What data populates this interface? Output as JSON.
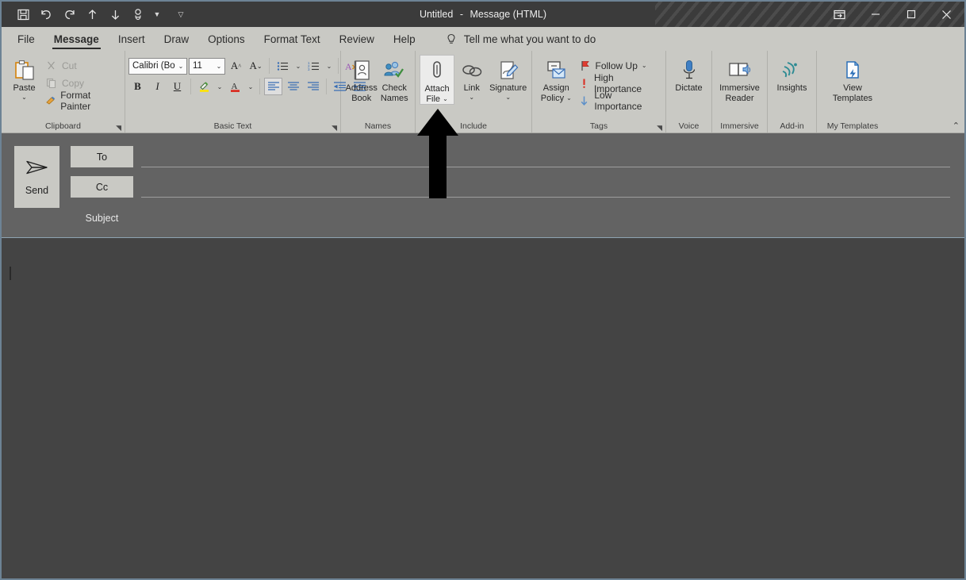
{
  "window": {
    "title_document": "Untitled",
    "title_separator": "-",
    "title_type": "Message (HTML)",
    "colors": {
      "titlebar": "#3b3b3b",
      "ribbon": "#c9c9c4",
      "compose_header": "#636363",
      "body": "#fdfdfd",
      "highlight": "#ececeb",
      "window_border": "#6d8395"
    }
  },
  "quick_access": {
    "items": [
      {
        "name": "save-icon",
        "label": "Save"
      },
      {
        "name": "undo-icon",
        "label": "Undo"
      },
      {
        "name": "redo-icon",
        "label": "Redo"
      },
      {
        "name": "previous-item-icon",
        "label": "Previous Item"
      },
      {
        "name": "next-item-icon",
        "label": "Next Item"
      },
      {
        "name": "touch-mouse-mode-icon",
        "label": "Touch/Mouse Mode"
      }
    ],
    "customize_label": "Customize Quick Access Toolbar"
  },
  "window_controls": {
    "ribbon_display_label": "Ribbon Display Options",
    "minimize_label": "Minimize",
    "maximize_label": "Maximize",
    "close_label": "Close"
  },
  "tabs": [
    {
      "label": "File",
      "active": false
    },
    {
      "label": "Message",
      "active": true
    },
    {
      "label": "Insert",
      "active": false
    },
    {
      "label": "Draw",
      "active": false
    },
    {
      "label": "Options",
      "active": false
    },
    {
      "label": "Format Text",
      "active": false
    },
    {
      "label": "Review",
      "active": false
    },
    {
      "label": "Help",
      "active": false
    }
  ],
  "tell_me": {
    "placeholder": "Tell me what you want to do",
    "icon": "lightbulb-icon"
  },
  "ribbon": {
    "collapse_label": "Collapse the Ribbon",
    "groups": {
      "clipboard": {
        "label": "Clipboard",
        "paste_label": "Paste",
        "has_launcher": true,
        "items": [
          {
            "label": "Cut",
            "icon": "scissors-icon",
            "disabled": true
          },
          {
            "label": "Copy",
            "icon": "copy-icon",
            "disabled": true
          },
          {
            "label": "Format Painter",
            "icon": "format-painter-icon",
            "disabled": false
          }
        ]
      },
      "basic_text": {
        "label": "Basic Text",
        "has_launcher": true,
        "font_name": "Calibri (Boc",
        "font_size": "11",
        "buttons_row1": [
          {
            "name": "grow-font-button",
            "label": "A"
          },
          {
            "name": "shrink-font-button",
            "label": "A"
          },
          {
            "name": "bullets-button",
            "label": "Bullets"
          },
          {
            "name": "numbering-button",
            "label": "Numbering"
          },
          {
            "name": "clear-formatting-button",
            "label": "Clear All Formatting"
          }
        ],
        "buttons_row2": [
          {
            "name": "bold-button",
            "label": "B"
          },
          {
            "name": "italic-button",
            "label": "I"
          },
          {
            "name": "underline-button",
            "label": "U"
          },
          {
            "name": "text-highlight-color-button",
            "label": "Text Highlight Color"
          },
          {
            "name": "font-color-button",
            "label": "Font Color"
          },
          {
            "name": "align-left-button",
            "label": "Align Left"
          },
          {
            "name": "align-center-button",
            "label": "Center"
          },
          {
            "name": "align-right-button",
            "label": "Align Right"
          },
          {
            "name": "decrease-indent-button",
            "label": "Decrease Indent"
          },
          {
            "name": "increase-indent-button",
            "label": "Increase Indent"
          }
        ]
      },
      "names": {
        "label": "Names",
        "items": [
          {
            "label": "Address\nBook",
            "line1": "Address",
            "line2": "Book",
            "icon": "address-book-icon"
          },
          {
            "label": "Check\nNames",
            "line1": "Check",
            "line2": "Names",
            "icon": "check-names-icon"
          }
        ]
      },
      "include": {
        "label": "Include",
        "items": [
          {
            "line1": "Attach",
            "line2": "File",
            "icon": "paperclip-icon",
            "has_dropdown": true,
            "highlighted": true
          },
          {
            "line1": "Link",
            "line2": "",
            "icon": "link-icon",
            "has_dropdown": true,
            "highlighted": false
          },
          {
            "line1": "Signature",
            "line2": "",
            "icon": "signature-icon",
            "has_dropdown": true,
            "highlighted": false
          }
        ]
      },
      "tags": {
        "label": "Tags",
        "has_launcher": true,
        "assign_policy_line1": "Assign",
        "assign_policy_line2": "Policy",
        "items": [
          {
            "label": "Follow Up",
            "icon": "flag-icon",
            "has_dropdown": true
          },
          {
            "label": "High Importance",
            "icon": "exclamation-icon",
            "has_dropdown": false
          },
          {
            "label": "Low Importance",
            "icon": "down-arrow-icon",
            "has_dropdown": false
          }
        ]
      },
      "voice": {
        "label": "Voice",
        "button_label": "Dictate",
        "icon": "microphone-icon"
      },
      "immersive": {
        "label": "Immersive",
        "line1": "Immersive",
        "line2": "Reader",
        "icon": "immersive-reader-icon"
      },
      "addin": {
        "label": "Add-in",
        "button_label": "Insights",
        "icon": "insights-icon"
      },
      "my_templates": {
        "label": "My Templates",
        "line1": "View",
        "line2": "Templates",
        "icon": "view-templates-icon"
      }
    }
  },
  "compose": {
    "send_label": "Send",
    "send_icon": "send-arrow-icon",
    "to_label": "To",
    "to_value": "",
    "cc_label": "Cc",
    "cc_value": "",
    "subject_label": "Subject",
    "subject_value": "",
    "body_value": ""
  },
  "annotation": {
    "arrow": "up-arrow-annotation",
    "points_to": "Attach File",
    "color": "#000000"
  },
  "cursor": {
    "type": "mouse-pointer",
    "over": "Attach File"
  }
}
